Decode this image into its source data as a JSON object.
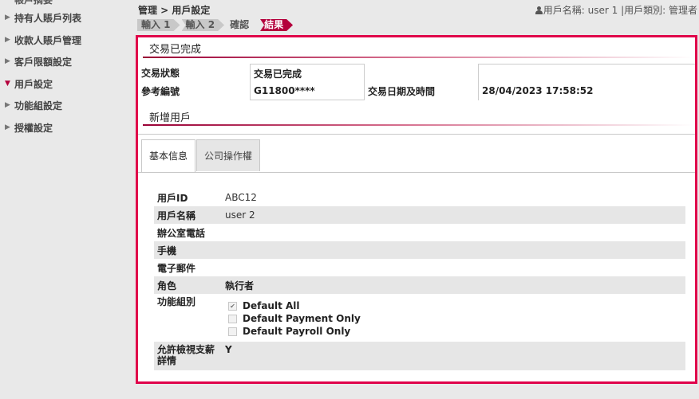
{
  "sidebar": {
    "cut_item": "帳戶摘要",
    "items": [
      {
        "label": "持有人賬戶列表",
        "state": "collapsed"
      },
      {
        "label": "收款人賬戶管理",
        "state": "collapsed"
      },
      {
        "label": "客戶限額設定",
        "state": "collapsed"
      },
      {
        "label": "用戶設定",
        "state": "expanded"
      },
      {
        "label": "功能組設定",
        "state": "collapsed"
      },
      {
        "label": "授權設定",
        "state": "collapsed"
      }
    ]
  },
  "header": {
    "breadcrumb": "管理 > 用戶設定",
    "user_name_label": "用戶名稱: user 1",
    "separator": "|",
    "user_type_label": "用戶類別: 管理者"
  },
  "steps": [
    "輸入 1",
    "輸入 2",
    "確認",
    "結果"
  ],
  "result": {
    "title": "交易已完成",
    "status_label": "交易狀態",
    "status_value": "交易已完成",
    "ref_label": "參考編號",
    "ref_value": "G11800****",
    "datetime_label": "交易日期及時間",
    "datetime_value": "28/04/2023 17:58:52"
  },
  "new_user": {
    "title": "新增用戶",
    "tabs": [
      "基本信息",
      "公司操作權"
    ],
    "fields": {
      "user_id_label": "用戶ID",
      "user_id_value": "ABC12",
      "user_name_label": "用戶名稱",
      "user_name_value": "user 2",
      "office_phone_label": "辦公室電話",
      "office_phone_value": "",
      "mobile_label": "手機",
      "mobile_value": "",
      "email_label": "電子郵件",
      "email_value": "",
      "role_label": "角色",
      "role_value": "執行者",
      "func_group_label": "功能組別",
      "func_groups": [
        {
          "label": "Default All",
          "checked": true
        },
        {
          "label": "Default Payment Only",
          "checked": false
        },
        {
          "label": "Default Payroll Only",
          "checked": false
        }
      ],
      "view_payee_label": "允許檢視支薪詳情",
      "view_payee_value": "Y"
    }
  },
  "colors": {
    "accent": "#b4003c",
    "frame_border": "#e0004a"
  }
}
